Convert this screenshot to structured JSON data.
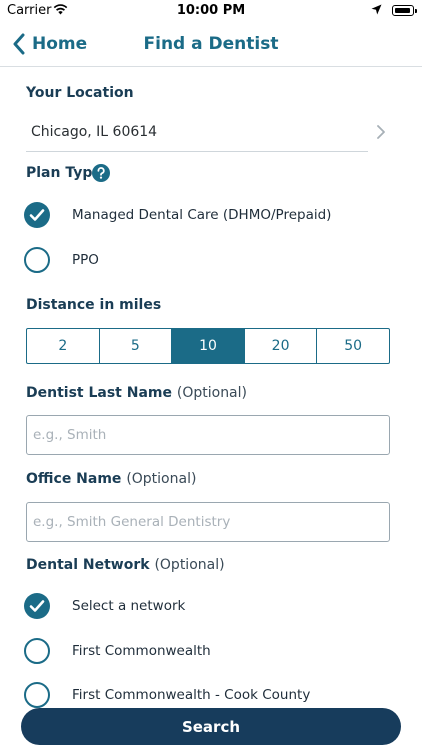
{
  "status_bar": {
    "carrier": "Carrier",
    "time": "10:00 PM"
  },
  "nav": {
    "back_label": "Home",
    "title": "Find a Dentist"
  },
  "location": {
    "label": "Your Location",
    "value": "Chicago, IL 60614"
  },
  "plan_type": {
    "label": "Plan Type",
    "options": [
      {
        "label": "Managed Dental Care (DHMO/Prepaid)",
        "checked": true
      },
      {
        "label": "PPO",
        "checked": false
      }
    ]
  },
  "distance": {
    "label": "Distance in miles",
    "options": [
      "2",
      "5",
      "10",
      "20",
      "50"
    ],
    "selected": "10"
  },
  "dentist_last_name": {
    "label": "Dentist Last Name",
    "optional": "(Optional)",
    "placeholder": "e.g., Smith",
    "value": ""
  },
  "office_name": {
    "label": "Office Name",
    "optional": "(Optional)",
    "placeholder": "e.g., Smith General Dentistry",
    "value": ""
  },
  "dental_network": {
    "label": "Dental Network",
    "optional": "(Optional)",
    "options": [
      {
        "label": "Select a network",
        "checked": true
      },
      {
        "label": "First Commonwealth",
        "checked": false
      },
      {
        "label": "First Commonwealth - Cook  County",
        "checked": false
      }
    ]
  },
  "search_button": {
    "label": "Search"
  },
  "colors": {
    "accent": "#1b6b87",
    "button": "#173c5c"
  }
}
